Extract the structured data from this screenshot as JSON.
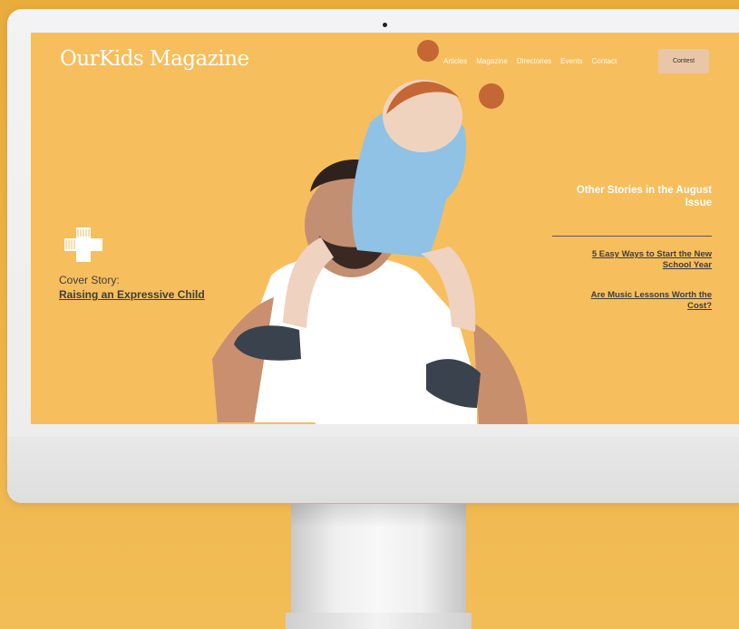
{
  "site": {
    "logo": "OurKids Magazine",
    "nav": [
      "Articles",
      "Magazine",
      "Directories",
      "Events",
      "Contact"
    ],
    "cta": "Contest"
  },
  "cover": {
    "label": "Cover Story:",
    "title": "Raising an Expressive Child"
  },
  "issue": {
    "title": "Other Stories in the August Issue",
    "stories": [
      "5 Easy Ways to Start the New School Year",
      "Are Music Lessons Worth the Cost?"
    ]
  },
  "colors": {
    "background": "#f0b64a",
    "hero_yellow": "#f7be5e",
    "contest_button": "#e9c6a7",
    "text_dark": "#3d3d3d",
    "text_light": "#ffffff"
  },
  "icons": {
    "brand_mark": "cross-logo-icon",
    "decoration": "heart-pattern-icon"
  }
}
